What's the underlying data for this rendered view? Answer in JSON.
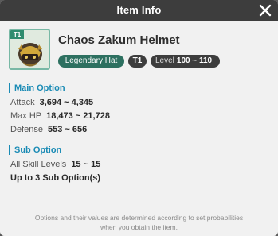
{
  "window": {
    "title": "Item Info"
  },
  "item": {
    "name": "Chaos Zakum Helmet",
    "tier_tag": "T1",
    "lock_tag": "",
    "rarity": "Legendary Hat",
    "tier": "T1",
    "level_label": "Level",
    "level_value": "100 ~ 110",
    "icon": "helmet-icon"
  },
  "main_option": {
    "heading": "Main Option",
    "stats": [
      {
        "label": "Attack",
        "value": "3,694 ~ 4,345"
      },
      {
        "label": "Max HP",
        "value": "18,473 ~ 21,728"
      },
      {
        "label": "Defense",
        "value": "553 ~ 656"
      }
    ]
  },
  "sub_option": {
    "heading": "Sub Option",
    "stats": [
      {
        "label": "All Skill Levels",
        "value": "15 ~ 15"
      }
    ],
    "note": "Up to 3 Sub Option(s)"
  },
  "footer": {
    "line1": "Options and their values are determined according to set probabilities",
    "line2": "when you obtain the item."
  },
  "colors": {
    "titlebar": "#3d3d3d",
    "accent_blue": "#1a8bb5",
    "rarity_green": "#2d7060"
  }
}
